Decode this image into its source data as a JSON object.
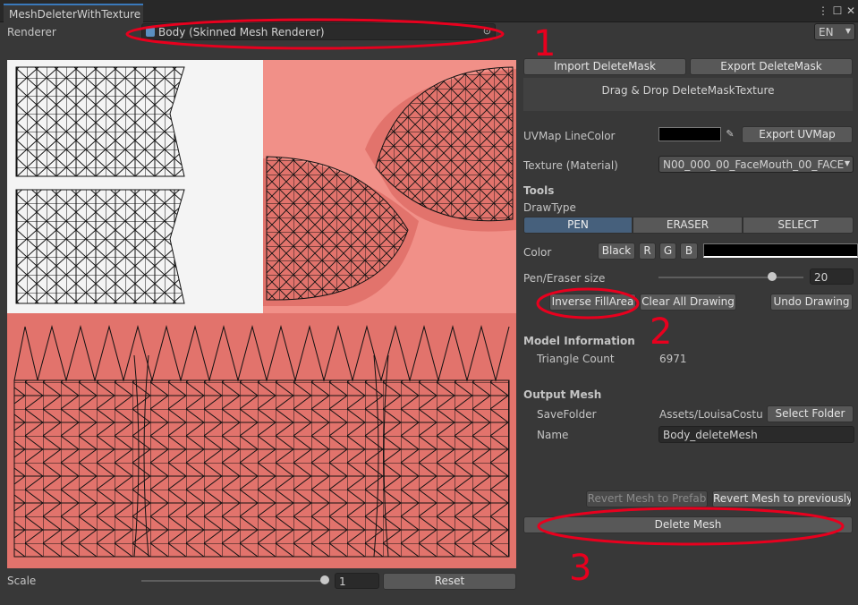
{
  "window": {
    "tab_title": "MeshDeleterWithTexture"
  },
  "renderer": {
    "label": "Renderer",
    "value": "Body (Skinned Mesh Renderer)",
    "language": "EN"
  },
  "mask": {
    "import_label": "Import DeleteMask",
    "export_label": "Export DeleteMask",
    "dropzone_text": "Drag & Drop DeleteMaskTexture"
  },
  "uvmap": {
    "line_color_label": "UVMap LineColor",
    "line_color": "#000000",
    "export_label": "Export UVMap"
  },
  "texture": {
    "label": "Texture (Material)",
    "value": "N00_000_00_FaceMouth_00_FACE"
  },
  "tools": {
    "heading": "Tools",
    "draw_type_label": "DrawType",
    "draw_types": [
      "PEN",
      "ERASER",
      "SELECT"
    ],
    "selected_draw_type": "PEN",
    "color_label": "Color",
    "color_black": "Black",
    "color_r": "R",
    "color_g": "G",
    "color_b": "B",
    "color_swatch": "#000000",
    "pen_size_label": "Pen/Eraser size",
    "pen_size_value": "20",
    "pen_size_fraction": 0.78,
    "inverse_fill_label": "Inverse FillArea",
    "clear_all_label": "Clear All Drawing",
    "undo_label": "Undo Drawing"
  },
  "model_info": {
    "heading": "Model Information",
    "triangle_count_label": "Triangle Count",
    "triangle_count_value": "6971"
  },
  "output": {
    "heading": "Output Mesh",
    "save_folder_label": "SaveFolder",
    "save_folder_value": "Assets/LouisaCostur",
    "select_folder_label": "Select Folder",
    "name_label": "Name",
    "name_value": "Body_deleteMesh",
    "revert_prefab_label": "Revert Mesh to Prefab",
    "revert_previous_label": "Revert Mesh to previously",
    "delete_mesh_label": "Delete Mesh"
  },
  "scale": {
    "label": "Scale",
    "value": "1",
    "slider_fraction": 1.0,
    "reset_label": "Reset"
  },
  "annotations": {
    "marker_1": "1",
    "marker_2": "2",
    "marker_3": "3",
    "ink_color": "#e8001e"
  }
}
